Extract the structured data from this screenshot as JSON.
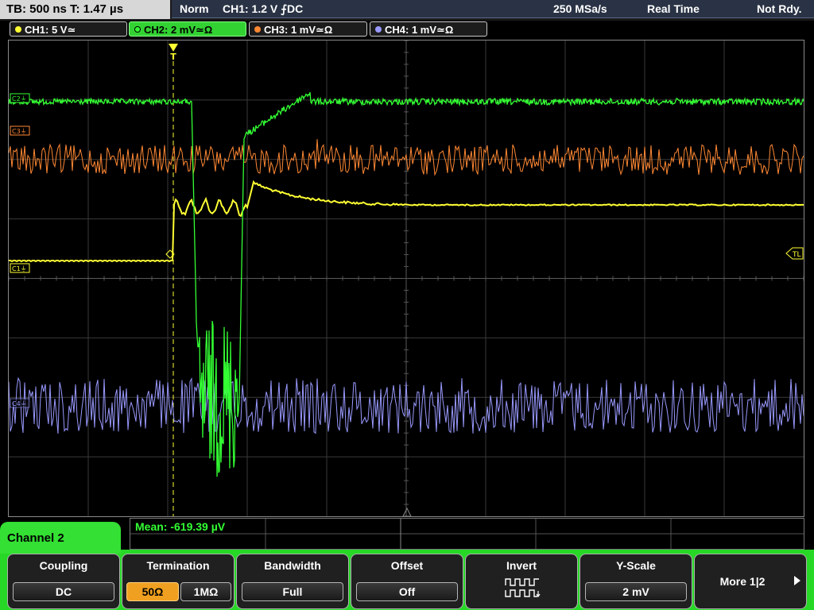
{
  "top": {
    "timebase": "TB: 500 ns   T: 1.47 µs",
    "trigger_mode": "Norm",
    "trigger_info": "CH1: 1.2 V ⨍DC",
    "sample_rate": "250 MSa/s",
    "acq_mode": "Real Time",
    "status": "Not Rdy."
  },
  "channels": [
    {
      "label": "CH1: 5 V≃",
      "color": "#ffff33"
    },
    {
      "label": "CH2: 2 mV≃Ω",
      "color": "#33ff33"
    },
    {
      "label": "CH3: 1 mV≃Ω",
      "color": "#ff8833"
    },
    {
      "label": "CH4: 1 mV≃Ω",
      "color": "#9999ff"
    }
  ],
  "markers": {
    "c1": "C1⏚",
    "c2": "C2⏚",
    "c3": "C3⏚",
    "c4": "C4⏚",
    "tl": "TL",
    "trigger": "T"
  },
  "measurement": {
    "text": "Mean: -619.39 µV"
  },
  "panel": {
    "title": "Channel 2",
    "keys": [
      {
        "label": "Coupling",
        "values": [
          "DC"
        ]
      },
      {
        "label": "Termination",
        "values": [
          "50Ω",
          "1MΩ"
        ],
        "selected": 0
      },
      {
        "label": "Bandwidth",
        "values": [
          "Full"
        ]
      },
      {
        "label": "Offset",
        "values": [
          "Off"
        ]
      },
      {
        "label": "Invert",
        "icon": "invert-waveform-icon"
      },
      {
        "label": "Y-Scale",
        "values": [
          "2 mV"
        ]
      },
      {
        "label": "More 1|2",
        "icon": "arrow-right-icon"
      }
    ]
  },
  "colors": {
    "ch1": "#ffff33",
    "ch2": "#33ff33",
    "ch3": "#ff8833",
    "ch4": "#9999ff",
    "panel": "#27d827",
    "selected": "#f0a020"
  }
}
